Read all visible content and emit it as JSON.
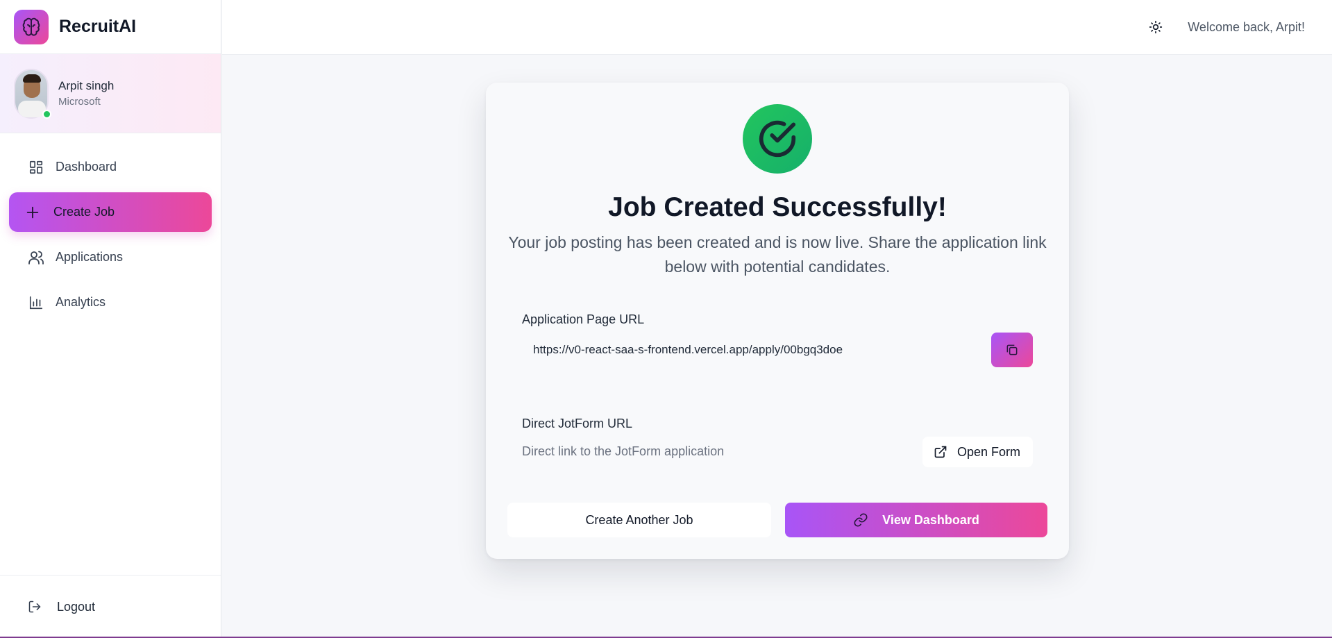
{
  "app": {
    "name": "RecruitAI"
  },
  "user": {
    "name": "Arpit singh",
    "company": "Microsoft",
    "status": "online"
  },
  "sidebar": {
    "items": [
      {
        "label": "Dashboard",
        "icon": "dashboard-icon",
        "active": false
      },
      {
        "label": "Create Job",
        "icon": "plus-icon",
        "active": true
      },
      {
        "label": "Applications",
        "icon": "users-icon",
        "active": false
      },
      {
        "label": "Analytics",
        "icon": "bar-chart-icon",
        "active": false
      }
    ],
    "logout_label": "Logout"
  },
  "header": {
    "welcome": "Welcome back, Arpit!",
    "theme_icon": "sun-icon"
  },
  "card": {
    "title": "Job Created Successfully!",
    "subtitle": "Your job posting has been created and is now live. Share the application link below with potential candidates.",
    "application_url_label": "Application Page URL",
    "application_url": "https://v0-react-saa-s-frontend.vercel.app/apply/00bgq3doe",
    "jotform_label": "Direct JotForm URL",
    "jotform_desc": "Direct link to the JotForm application",
    "open_form_label": "Open Form",
    "create_another_label": "Create Another Job",
    "view_dashboard_label": "View Dashboard"
  },
  "colors": {
    "accent_start": "#a855f7",
    "accent_end": "#ec4899",
    "success": "#22c55e",
    "online": "#22c55e"
  }
}
